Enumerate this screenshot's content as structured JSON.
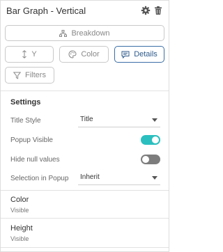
{
  "header": {
    "title": "Bar Graph - Vertical"
  },
  "buttons": {
    "breakdown": "Breakdown",
    "y": "Y",
    "color": "Color",
    "details": "Details",
    "filters": "Filters"
  },
  "settings": {
    "title": "Settings",
    "title_style": {
      "label": "Title Style",
      "value": "Title"
    },
    "popup_visible": {
      "label": "Popup Visible",
      "on": true
    },
    "hide_null": {
      "label": "Hide null values",
      "on": false
    },
    "selection_popup": {
      "label": "Selection in Popup",
      "value": "Inherit"
    }
  },
  "properties": [
    {
      "name": "Color",
      "value": "Visible"
    },
    {
      "name": "Height",
      "value": "Visible"
    }
  ],
  "colors": {
    "accent": "#2d5a8a",
    "toggle_on": "#2bbfbf",
    "toggle_off": "#7d7d7d"
  },
  "icons": {
    "settings": "gear-icon",
    "delete": "trash-icon",
    "breakdown": "hierarchy-icon",
    "y": "vertical-arrows-icon",
    "color": "palette-icon",
    "details": "speech-bubble-icon",
    "filters": "funnel-icon"
  }
}
